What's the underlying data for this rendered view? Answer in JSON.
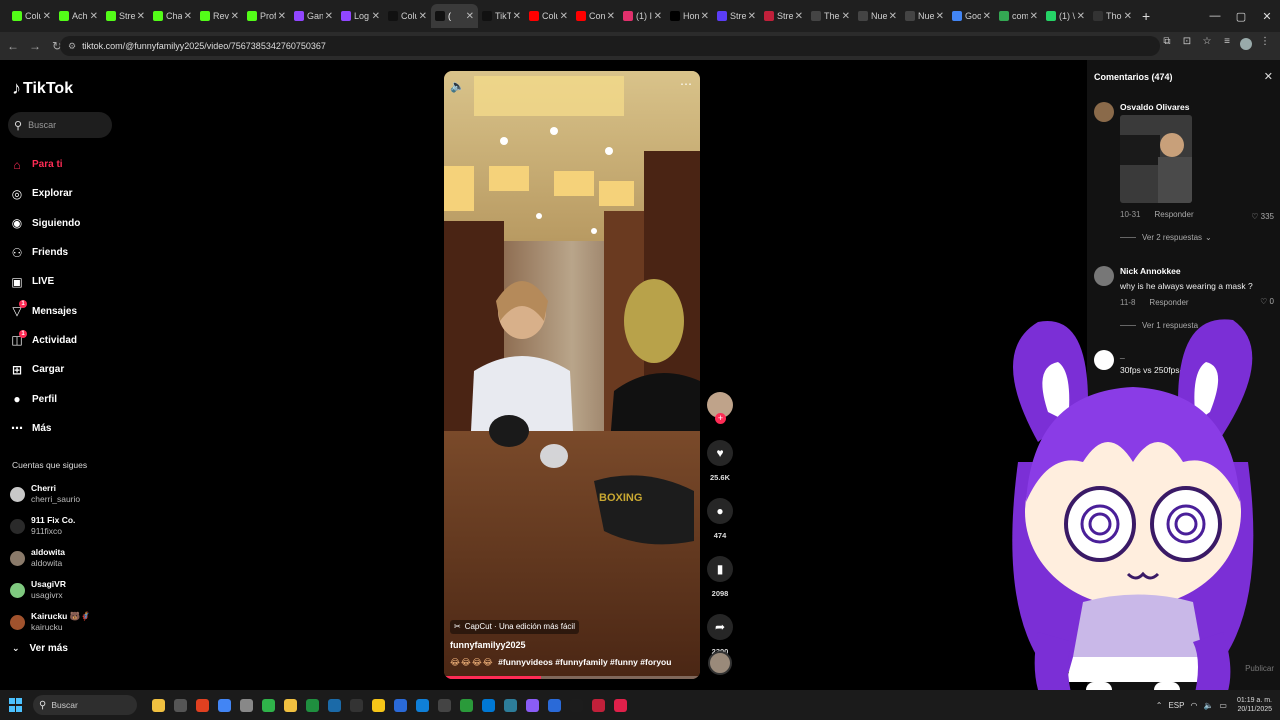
{
  "browser": {
    "tabs": [
      {
        "label": "Colu",
        "icon": "kick-icon",
        "color": "#53fc18"
      },
      {
        "label": "Achi",
        "icon": "kick-icon",
        "color": "#53fc18"
      },
      {
        "label": "Stre",
        "icon": "kick-icon",
        "color": "#53fc18"
      },
      {
        "label": "Cha",
        "icon": "kick-icon",
        "color": "#53fc18"
      },
      {
        "label": "Revi",
        "icon": "kick-icon",
        "color": "#53fc18"
      },
      {
        "label": "Prof",
        "icon": "kick-icon",
        "color": "#53fc18"
      },
      {
        "label": "Gan",
        "icon": "twitch-icon",
        "color": "#9146ff"
      },
      {
        "label": "Log",
        "icon": "twitch-icon",
        "color": "#9146ff"
      },
      {
        "label": "Colu",
        "icon": "tiktok-icon",
        "color": "#111111"
      },
      {
        "label": "(",
        "icon": "tiktok-icon",
        "color": "#111111",
        "active": true
      },
      {
        "label": "TikT",
        "icon": "tiktok-icon",
        "color": "#111111"
      },
      {
        "label": "Colu",
        "icon": "youtube-icon",
        "color": "#ff0000"
      },
      {
        "label": "Con",
        "icon": "youtube-icon",
        "color": "#ff0000"
      },
      {
        "label": "(1) I",
        "icon": "instagram-icon",
        "color": "#e1306c"
      },
      {
        "label": "Hon",
        "icon": "x-icon",
        "color": "#000000"
      },
      {
        "label": "Stre",
        "icon": "streamlabs-icon",
        "color": "#5b3df5"
      },
      {
        "label": "Stre",
        "icon": "streamelements-icon",
        "color": "#c0203a"
      },
      {
        "label": "The",
        "icon": "diamond-icon",
        "color": "#444444"
      },
      {
        "label": "Nue",
        "icon": "globe-icon",
        "color": "#444444"
      },
      {
        "label": "Nue",
        "icon": "globe-icon",
        "color": "#444444"
      },
      {
        "label": "Goo",
        "icon": "google-icon",
        "color": "#4285f4"
      },
      {
        "label": "com",
        "icon": "chrome-icon",
        "color": "#34a853"
      },
      {
        "label": "(1) \\",
        "icon": "whatsapp-icon",
        "color": "#25d366"
      },
      {
        "label": "Tho",
        "icon": "bolt-icon",
        "color": "#333333"
      }
    ],
    "new_tab": "+",
    "url": "tiktok.com/@funnyfamilyy2025/video/7567385342760750367"
  },
  "tiktok": {
    "logo": "TikTok",
    "search_placeholder": "Buscar",
    "nav": [
      {
        "label": "Para ti",
        "icon": "home-icon",
        "active": true
      },
      {
        "label": "Explorar",
        "icon": "compass-icon"
      },
      {
        "label": "Siguiendo",
        "icon": "following-icon"
      },
      {
        "label": "Friends",
        "icon": "friends-icon"
      },
      {
        "label": "LIVE",
        "icon": "live-icon"
      },
      {
        "label": "Mensajes",
        "icon": "messages-icon",
        "badge": "1"
      },
      {
        "label": "Actividad",
        "icon": "activity-icon",
        "badge": "1"
      },
      {
        "label": "Cargar",
        "icon": "upload-icon"
      },
      {
        "label": "Perfil",
        "icon": "profile-icon"
      },
      {
        "label": "Más",
        "icon": "more-icon"
      }
    ],
    "following_title": "Cuentas que sigues",
    "following": [
      {
        "name": "Cherri",
        "user": "cherri_saurio",
        "color": "#c8c8c8"
      },
      {
        "name": "911 Fix Co.",
        "user": "911fixco",
        "color": "#2a2a2a"
      },
      {
        "name": "aldowita",
        "user": "aldowita",
        "color": "#8a7a6a"
      },
      {
        "name": "UsagiVR",
        "user": "usagivrx",
        "color": "#7fc97f"
      },
      {
        "name": "Kairucku 🐻🦸",
        "user": "kairucku",
        "color": "#a0522d"
      }
    ],
    "ver_mas": "Ver más"
  },
  "video": {
    "capcut": "CapCut · Una edición más fácil",
    "username": "funnyfamilyy2025",
    "emojis": "😂😂😂😂",
    "hashtags": "#funnyvideos #funnyfamily #funny #foryou",
    "progress": 0.38,
    "likes": "25.6K",
    "comments": "474",
    "saves": "2098",
    "shares": "2300"
  },
  "comments": {
    "header": "Comentarios (474)",
    "items": [
      {
        "name": "Osvaldo Olivares",
        "text": "",
        "date": "10-31",
        "reply": "Responder",
        "likes": "335",
        "view_replies": "Ver 2 respuestas",
        "color": "#8a6a4a"
      },
      {
        "name": "Nick Annokkee",
        "text": "why is he always wearing a mask ?",
        "date": "11-8",
        "reply": "Responder",
        "likes": "0",
        "view_replies": "Ver 1 respuesta",
        "color": "#777777"
      },
      {
        "name": "_",
        "text": "30fps vs 250fps😂",
        "color": "#ffffff"
      }
    ],
    "publicar": "Publicar"
  },
  "taskbar": {
    "search": "Buscar",
    "lang": "ESP",
    "time": "01:19 a. m.",
    "date": "20/11/2025",
    "apps": [
      "#f0c040",
      "#555555",
      "#e04020",
      "#4285f4",
      "#888888",
      "#2fb34a",
      "#f0c040",
      "#1f8f3f",
      "#1b6aa8",
      "#333333",
      "#f5c518",
      "#2a6ad8",
      "#0f7fd8",
      "#444444",
      "#2a9a3a",
      "#0078d4",
      "#2d7d9a",
      "#8a5cf6",
      "#2a6ad8",
      "#1c1c1c",
      "#c0203a",
      "#e0204a"
    ]
  }
}
